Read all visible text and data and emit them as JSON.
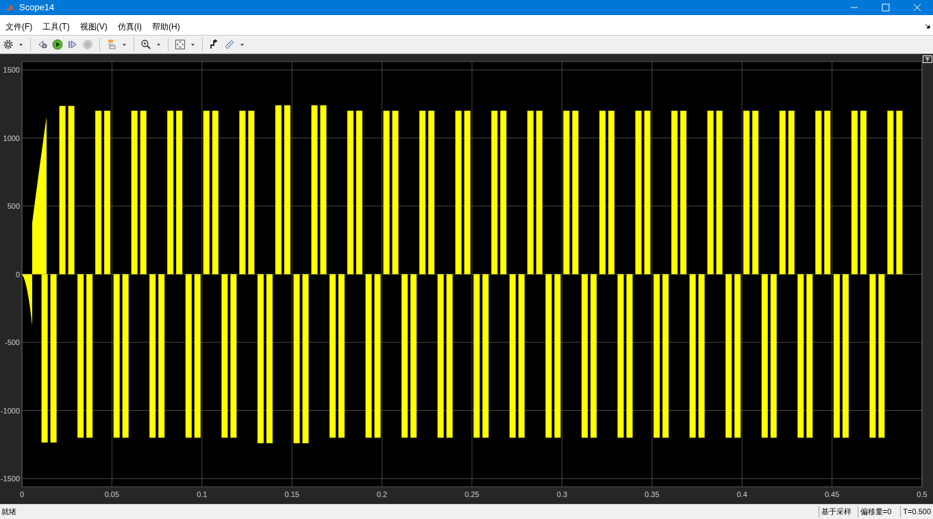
{
  "window": {
    "title": "Scope14"
  },
  "menu": [
    "文件(F)",
    "工具(T)",
    "视图(V)",
    "仿真(I)",
    "帮助(H)"
  ],
  "toolbar": [
    {
      "kind": "settings",
      "dropdown": true,
      "disabled": false
    },
    {
      "kind": "separator"
    },
    {
      "kind": "step-back",
      "dropdown": false,
      "disabled": false
    },
    {
      "kind": "run",
      "dropdown": false,
      "disabled": false
    },
    {
      "kind": "step-forward",
      "dropdown": false,
      "disabled": false
    },
    {
      "kind": "stop",
      "dropdown": false,
      "disabled": true
    },
    {
      "kind": "separator"
    },
    {
      "kind": "signals",
      "dropdown": true,
      "disabled": false
    },
    {
      "kind": "separator"
    },
    {
      "kind": "zoom",
      "dropdown": true,
      "disabled": false
    },
    {
      "kind": "separator"
    },
    {
      "kind": "fit",
      "dropdown": true,
      "disabled": false
    },
    {
      "kind": "separator"
    },
    {
      "kind": "trigger",
      "dropdown": false,
      "disabled": false
    },
    {
      "kind": "measure",
      "dropdown": true,
      "disabled": false
    }
  ],
  "plot": {
    "y_ticks": [
      "1500",
      "1000",
      "500",
      "0",
      "-500",
      "-1000",
      "-1500"
    ],
    "x_ticks": [
      "0",
      "0.05",
      "0.1",
      "0.15",
      "0.2",
      "0.25",
      "0.3",
      "0.35",
      "0.4",
      "0.45",
      "0.5"
    ]
  },
  "status_bar": {
    "message": "就绪",
    "sampling": "基于采样",
    "offset": "偏移量=0",
    "time": "T=0.500"
  }
}
